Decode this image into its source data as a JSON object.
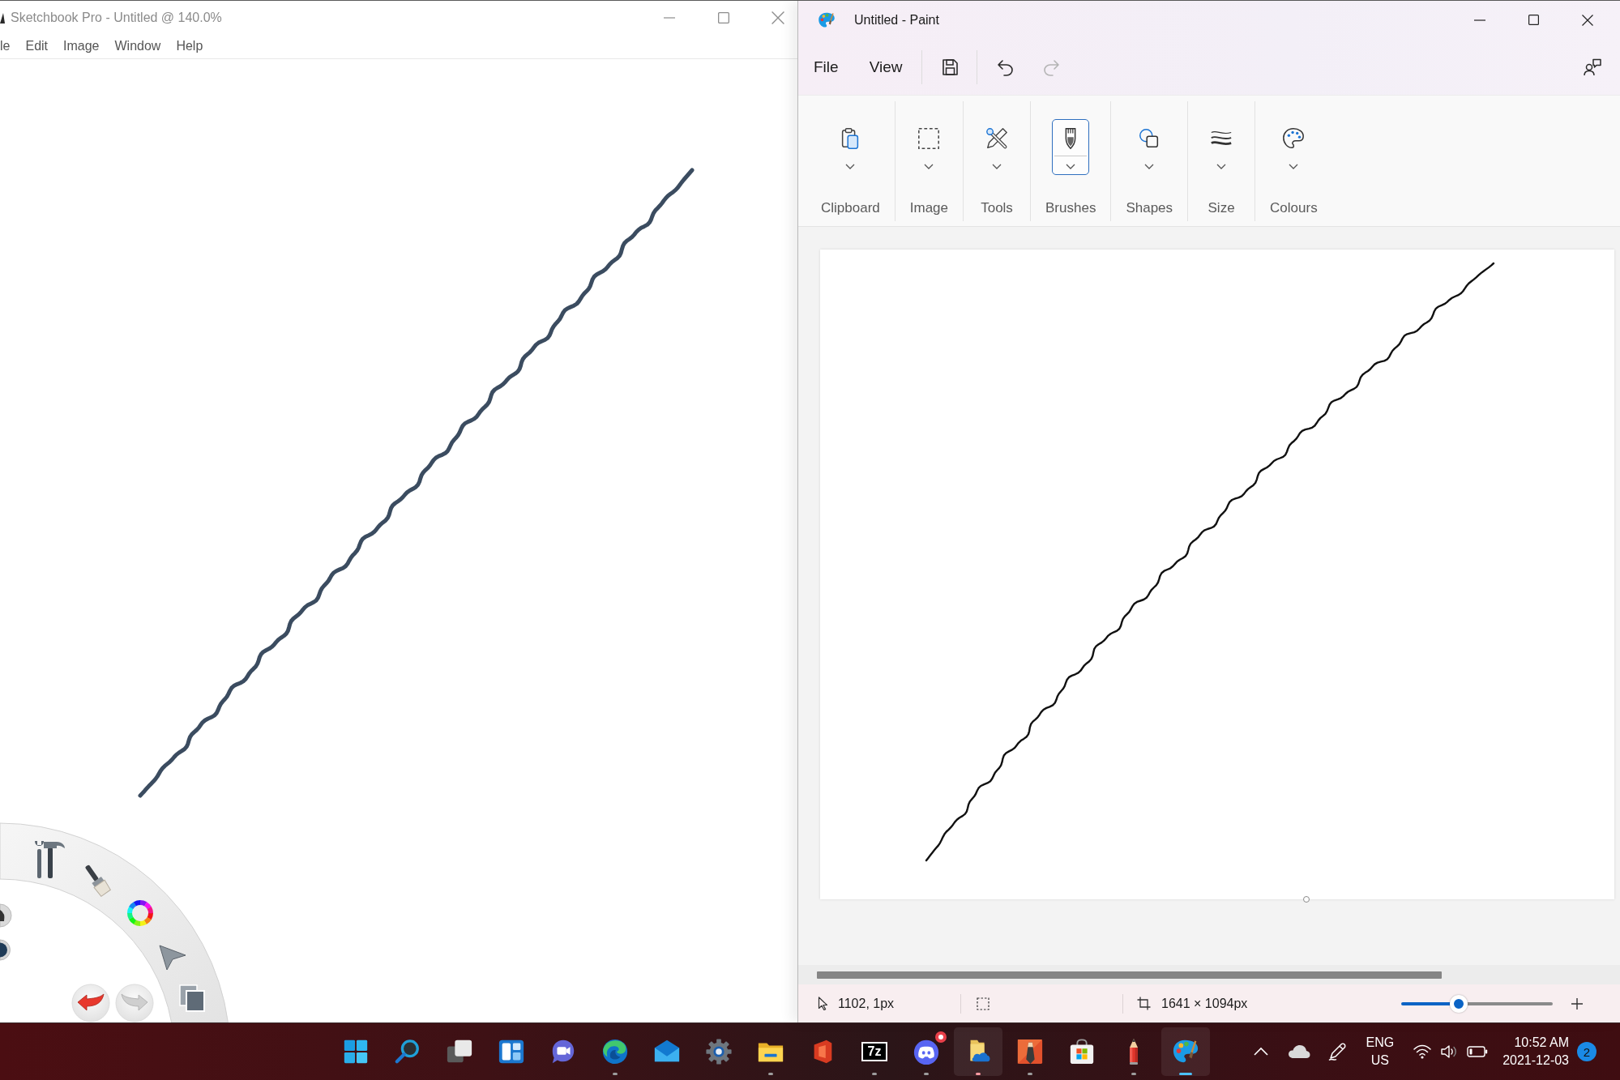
{
  "sketchbook_window": {
    "title": "Sketchbook Pro - Untitled @ 140.0%",
    "menu": [
      "le",
      "Edit",
      "Image",
      "Window",
      "Help"
    ],
    "history": [
      {
        "kind": "undo",
        "disabled": false
      },
      {
        "kind": "redo",
        "disabled": true
      }
    ]
  },
  "paint_window": {
    "title": "Untitled - Paint",
    "menu": [
      "File",
      "View"
    ],
    "quick_actions": [
      {
        "kind": "save",
        "disabled": false
      },
      {
        "kind": "undo",
        "disabled": false
      },
      {
        "kind": "redo",
        "disabled": true
      }
    ],
    "ribbon": [
      {
        "kind": "clipboard",
        "label": "Clipboard",
        "selected": false
      },
      {
        "kind": "image",
        "label": "Image",
        "selected": false
      },
      {
        "kind": "tools",
        "label": "Tools",
        "selected": false
      },
      {
        "kind": "brushes",
        "label": "Brushes",
        "selected": true
      },
      {
        "kind": "shapes",
        "label": "Shapes",
        "selected": false
      },
      {
        "kind": "size",
        "label": "Size",
        "selected": false
      },
      {
        "kind": "colours",
        "label": "Colours",
        "selected": false
      }
    ],
    "status_bar": {
      "cursor_position": "1102, 1px",
      "canvas_size": "1641 × 1094px",
      "zoom": {
        "level": 0.38
      }
    }
  },
  "taskbar": {
    "apps": [
      {
        "kind": "start",
        "running": false,
        "selected": false,
        "attention": false,
        "badge": false
      },
      {
        "kind": "search",
        "running": false,
        "selected": false,
        "attention": false,
        "badge": false
      },
      {
        "kind": "task_view",
        "running": false,
        "selected": false,
        "attention": false,
        "badge": false
      },
      {
        "kind": "widgets",
        "running": false,
        "selected": false,
        "attention": false,
        "badge": false
      },
      {
        "kind": "meet",
        "running": false,
        "selected": false,
        "attention": false,
        "badge": false
      },
      {
        "kind": "browser",
        "running": true,
        "selected": false,
        "attention": false,
        "badge": false
      },
      {
        "kind": "mail",
        "running": false,
        "selected": false,
        "attention": false,
        "badge": false
      },
      {
        "kind": "settings",
        "running": false,
        "selected": false,
        "attention": false,
        "badge": false
      },
      {
        "kind": "files",
        "running": true,
        "selected": false,
        "attention": false,
        "badge": false
      },
      {
        "kind": "office",
        "running": false,
        "selected": false,
        "attention": false,
        "badge": false
      },
      {
        "kind": "archiver",
        "text": "7z",
        "running": true,
        "selected": false,
        "attention": false,
        "badge": false
      },
      {
        "kind": "chat",
        "running": true,
        "selected": false,
        "attention": false,
        "badge": true
      },
      {
        "kind": "cloud_folder",
        "running": true,
        "selected": false,
        "attention": true,
        "badge": false
      },
      {
        "kind": "sketch",
        "running": true,
        "selected": false,
        "attention": false,
        "badge": false
      },
      {
        "kind": "store",
        "running": false,
        "selected": false,
        "attention": false,
        "badge": false
      },
      {
        "kind": "pencil",
        "running": true,
        "selected": false,
        "attention": false,
        "badge": false
      },
      {
        "kind": "paint",
        "running": true,
        "selected": true,
        "attention": false,
        "badge": false
      }
    ],
    "tray": {
      "language": "ENG",
      "region": "US",
      "time": "10:52 AM",
      "date": "2021-12-03",
      "notification_count": "2"
    }
  }
}
